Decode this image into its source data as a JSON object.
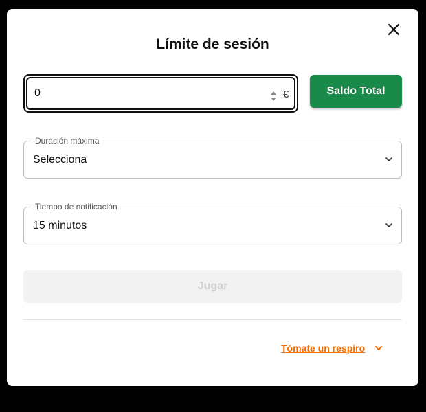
{
  "modal": {
    "title": "Límite de sesión"
  },
  "amount": {
    "value": "0",
    "currency": "€"
  },
  "saldo_button": {
    "label": "Saldo Total"
  },
  "duracion": {
    "legend": "Duración máxima",
    "selected": "Selecciona"
  },
  "tiempo": {
    "legend": "Tiempo de notificación",
    "selected": "15 minutos"
  },
  "jugar_button": {
    "label": "Jugar"
  },
  "respiro_link": {
    "label": "Tómate un respiro"
  },
  "colors": {
    "primary_green": "#1a8a4a",
    "link_orange": "#ef6c00",
    "disabled_bg": "#f2f2f2",
    "disabled_text": "#cfcfcf"
  },
  "icons": {
    "close": "close-icon",
    "stepper": "stepper-arrows-icon",
    "chevron": "chevron-down-icon"
  }
}
